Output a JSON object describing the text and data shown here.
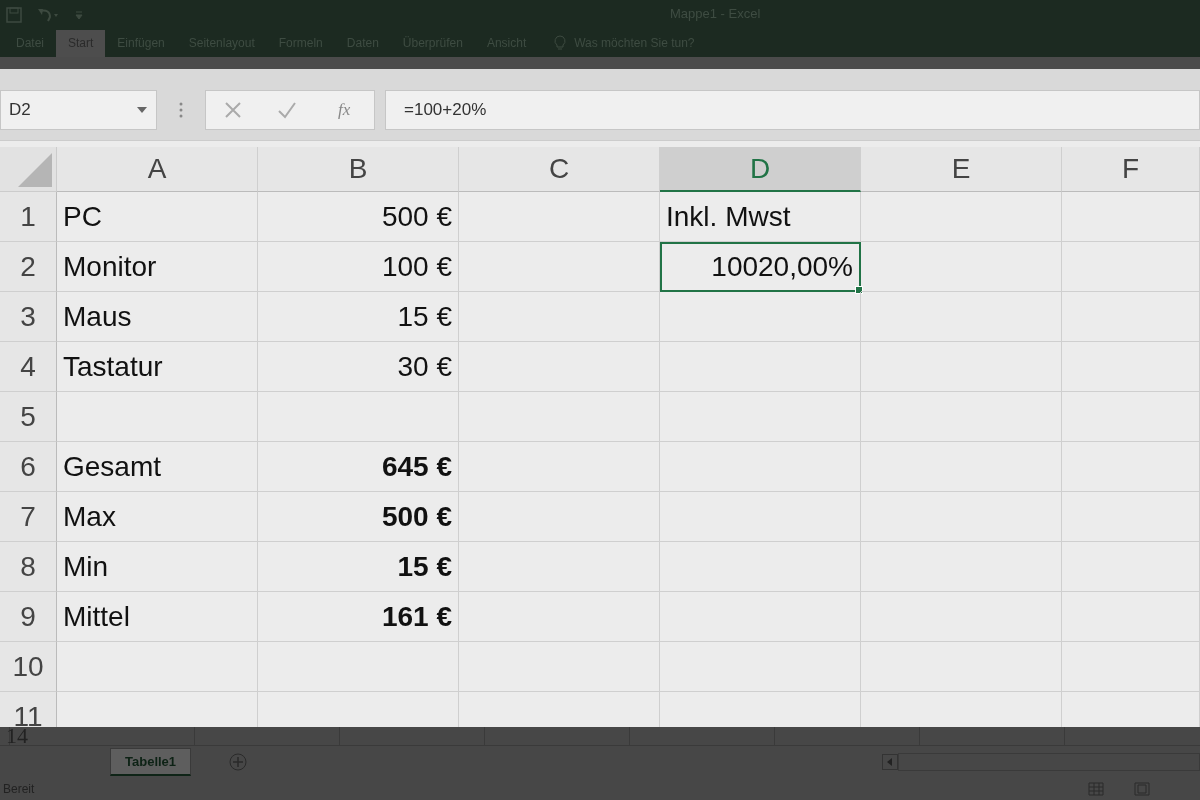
{
  "window": {
    "title": "Mappe1 - Excel"
  },
  "ribbon_tabs": [
    {
      "label": "Datei",
      "selected": false
    },
    {
      "label": "Start",
      "selected": true
    },
    {
      "label": "Einfügen",
      "selected": false
    },
    {
      "label": "Seitenlayout",
      "selected": false
    },
    {
      "label": "Formeln",
      "selected": false
    },
    {
      "label": "Daten",
      "selected": false
    },
    {
      "label": "Überprüfen",
      "selected": false
    },
    {
      "label": "Ansicht",
      "selected": false
    }
  ],
  "tell_me": {
    "placeholder": "Was möchten Sie tun?"
  },
  "formula_bar": {
    "name_box": "D2",
    "fx": "fx",
    "formula": "=100+20%"
  },
  "columns": [
    {
      "label": "A",
      "selected": false
    },
    {
      "label": "B",
      "selected": false
    },
    {
      "label": "C",
      "selected": false
    },
    {
      "label": "D",
      "selected": true
    },
    {
      "label": "E",
      "selected": false
    },
    {
      "label": "F",
      "selected": false
    }
  ],
  "rows": [
    {
      "number": "1",
      "cells": [
        {
          "value": "PC",
          "kind": "text",
          "bold": false,
          "selected": false
        },
        {
          "value": "500 €",
          "kind": "number",
          "bold": false,
          "selected": false
        },
        null,
        {
          "value": "Inkl. Mwst",
          "kind": "text",
          "bold": false,
          "selected": false
        },
        null,
        null
      ]
    },
    {
      "number": "2",
      "cells": [
        {
          "value": "Monitor",
          "kind": "text",
          "bold": false,
          "selected": false
        },
        {
          "value": "100 €",
          "kind": "number",
          "bold": false,
          "selected": false
        },
        null,
        {
          "value": "10020,00%",
          "kind": "number",
          "bold": false,
          "selected": true
        },
        null,
        null
      ]
    },
    {
      "number": "3",
      "cells": [
        {
          "value": "Maus",
          "kind": "text",
          "bold": false,
          "selected": false
        },
        {
          "value": "15 €",
          "kind": "number",
          "bold": false,
          "selected": false
        },
        null,
        null,
        null,
        null
      ]
    },
    {
      "number": "4",
      "cells": [
        {
          "value": "Tastatur",
          "kind": "text",
          "bold": false,
          "selected": false
        },
        {
          "value": "30 €",
          "kind": "number",
          "bold": false,
          "selected": false
        },
        null,
        null,
        null,
        null
      ]
    },
    {
      "number": "5",
      "cells": [
        null,
        null,
        null,
        null,
        null,
        null
      ]
    },
    {
      "number": "6",
      "cells": [
        {
          "value": "Gesamt",
          "kind": "text",
          "bold": false,
          "selected": false
        },
        {
          "value": "645 €",
          "kind": "number",
          "bold": true,
          "selected": false
        },
        null,
        null,
        null,
        null
      ]
    },
    {
      "number": "7",
      "cells": [
        {
          "value": "Max",
          "kind": "text",
          "bold": false,
          "selected": false
        },
        {
          "value": "500 €",
          "kind": "number",
          "bold": true,
          "selected": false
        },
        null,
        null,
        null,
        null
      ]
    },
    {
      "number": "8",
      "cells": [
        {
          "value": "Min",
          "kind": "text",
          "bold": false,
          "selected": false
        },
        {
          "value": "15 €",
          "kind": "number",
          "bold": true,
          "selected": false
        },
        null,
        null,
        null,
        null
      ]
    },
    {
      "number": "9",
      "cells": [
        {
          "value": "Mittel",
          "kind": "text",
          "bold": false,
          "selected": false
        },
        {
          "value": "161 €",
          "kind": "number",
          "bold": true,
          "selected": false
        },
        null,
        null,
        null,
        null
      ]
    },
    {
      "number": "10",
      "cells": [
        null,
        null,
        null,
        null,
        null,
        null
      ]
    },
    {
      "number": "11",
      "cells": [
        null,
        null,
        null,
        null,
        null,
        null
      ]
    }
  ],
  "background_row": "14",
  "sheet_tabs": [
    {
      "label": "Tabelle1",
      "selected": true
    }
  ],
  "status_bar": {
    "text": "Bereit"
  }
}
